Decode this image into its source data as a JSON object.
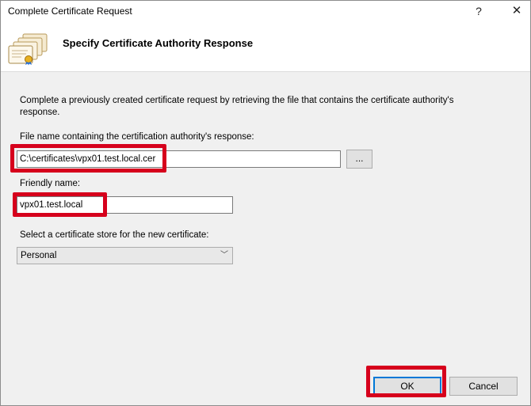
{
  "window": {
    "title": "Complete Certificate Request",
    "help_label": "?",
    "close_label": "✕"
  },
  "header": {
    "title": "Specify Certificate Authority Response",
    "icon": "certificate-stack-icon"
  },
  "main": {
    "description": "Complete a previously created certificate request by retrieving the file that contains the certificate authority's response.",
    "file_label": "File name containing the certification authority's response:",
    "file_value": "C:\\certificates\\vpx01.test.local.cer",
    "browse_label": "...",
    "friendly_label": "Friendly name:",
    "friendly_value": "vpx01.test.local",
    "store_label": "Select a certificate store for the new certificate:",
    "store_selected": "Personal",
    "store_chevron": "﹀"
  },
  "footer": {
    "ok_label": "OK",
    "cancel_label": "Cancel"
  },
  "colors": {
    "highlight": "#d6001c",
    "accent": "#0078d7",
    "dialog_background": "#f0f0f0"
  }
}
